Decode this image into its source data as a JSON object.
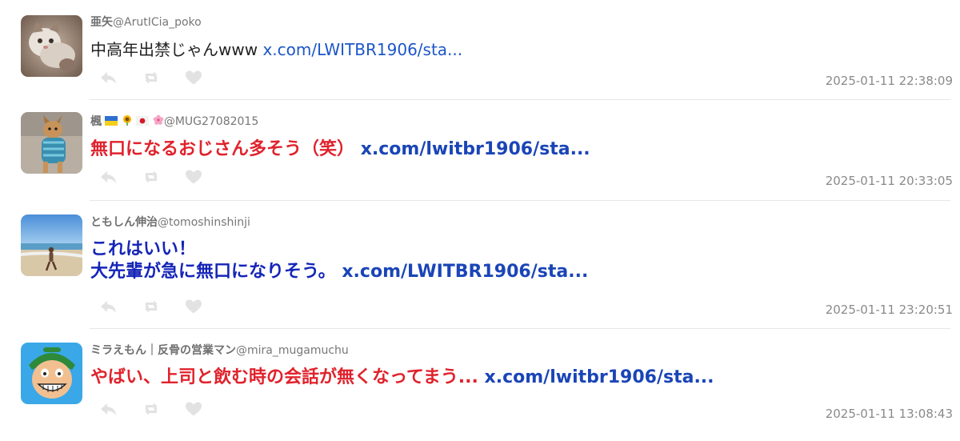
{
  "tweets": [
    {
      "display_name": "亜矢",
      "handle": "@ArutICia_poko",
      "text_lines": [
        "中高年出禁じゃんwww"
      ],
      "link": "x.com/LWITBR1906/sta...",
      "timestamp": "2025-01-11 22:38:09",
      "avatar_icon": "cat-photo-avatar",
      "style": "plain"
    },
    {
      "display_name": "楓",
      "name_emojis": [
        "ukraine-flag-icon",
        "sunflower-icon",
        "japan-flag-icon",
        "cherry-blossom-icon"
      ],
      "handle": "@MUG27082015",
      "text_lines": [
        "無口になるおじさん多そう（笑）"
      ],
      "link": "x.com/lwitbr1906/sta...",
      "timestamp": "2025-01-11 20:33:05",
      "avatar_icon": "dog-photo-avatar",
      "style": "red"
    },
    {
      "display_name": "ともしん伸治",
      "handle": "@tomoshinshinji",
      "text_lines": [
        "これはいい！",
        "大先輩が急に無口になりそう。"
      ],
      "link": "x.com/LWITBR1906/sta...",
      "timestamp": "2025-01-11 23:20:51",
      "avatar_icon": "beach-photo-avatar",
      "style": "blue"
    },
    {
      "display_name": "ミラえもん｜反骨の営業マン",
      "handle": "@mira_mugamuchu",
      "text_lines": [
        "やばい、上司と飲む時の会話が無くなってまう..."
      ],
      "link": "x.com/lwitbr1906/sta...",
      "timestamp": "2025-01-11 13:08:43",
      "avatar_icon": "cartoon-man-avatar",
      "style": "red"
    }
  ],
  "action_icons": [
    "reply-icon",
    "retweet-icon",
    "like-icon"
  ],
  "colors": {
    "link_blue": "#1a45b7",
    "red_text": "#e0222c",
    "blue_text": "#1525b8",
    "icon_gray": "#e2e2e2",
    "timestamp_gray": "#8a8a8a"
  }
}
